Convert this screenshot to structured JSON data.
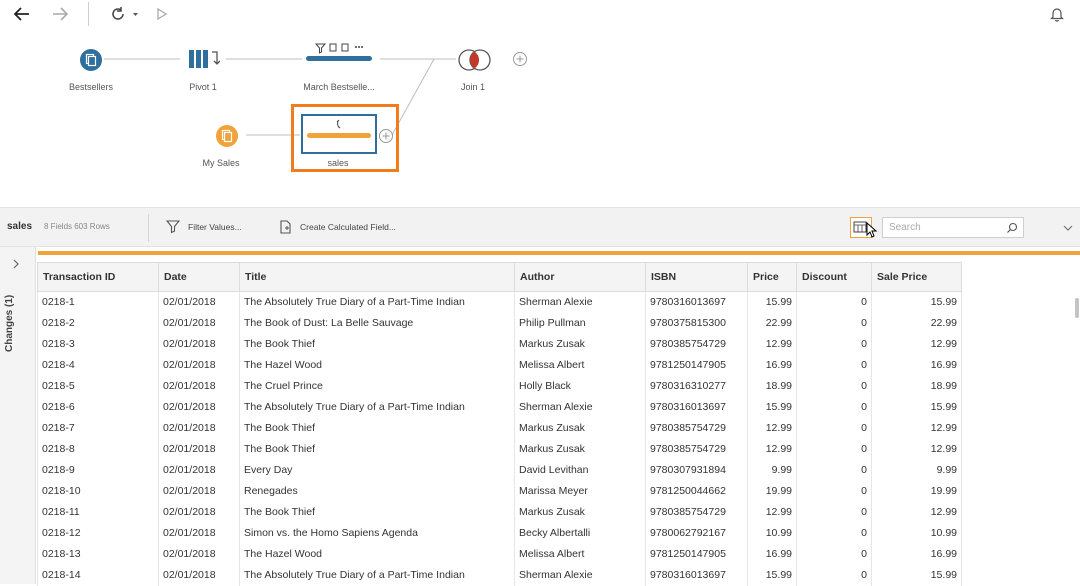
{
  "toolbar": {
    "back": "back-icon",
    "forward": "forward-icon",
    "refresh": "refresh-icon",
    "run": "run-icon",
    "alerts": "bell-icon"
  },
  "flow": {
    "nodes": [
      {
        "id": "bestsellers",
        "label": "Bestsellers",
        "type": "input",
        "color": "#2e6f9e"
      },
      {
        "id": "pivot",
        "label": "Pivot 1",
        "type": "pivot",
        "color": "#2e6f9e"
      },
      {
        "id": "march",
        "label": "March Bestselle...",
        "type": "clean",
        "color": "#2e6f9e"
      },
      {
        "id": "join",
        "label": "Join 1",
        "type": "join",
        "color": "#c0392b"
      },
      {
        "id": "mysales",
        "label": "My Sales",
        "type": "input",
        "color": "#f0a33a"
      },
      {
        "id": "sales",
        "label": "sales",
        "type": "clean",
        "color": "#f0a33a"
      }
    ],
    "highlight_color": "#f07c1e"
  },
  "profile": {
    "step_name": "sales",
    "meta": "8 Fields  603 Rows",
    "filter_label": "Filter Values...",
    "calc_label": "Create Calculated Field...",
    "search_placeholder": "Search"
  },
  "changes": {
    "label": "Changes (1)"
  },
  "table": {
    "columns": [
      "Transaction ID",
      "Date",
      "Title",
      "Author",
      "ISBN",
      "Price",
      "Discount",
      "Sale Price"
    ],
    "rows": [
      [
        "0218-1",
        "02/01/2018",
        "The Absolutely True Diary of a Part-Time Indian",
        "Sherman Alexie",
        "9780316013697",
        "15.99",
        "0",
        "15.99"
      ],
      [
        "0218-2",
        "02/01/2018",
        "The Book of Dust: La Belle Sauvage",
        "Philip Pullman",
        "9780375815300",
        "22.99",
        "0",
        "22.99"
      ],
      [
        "0218-3",
        "02/01/2018",
        "The Book Thief",
        "Markus Zusak",
        "9780385754729",
        "12.99",
        "0",
        "12.99"
      ],
      [
        "0218-4",
        "02/01/2018",
        "The Hazel Wood",
        "Melissa Albert",
        "9781250147905",
        "16.99",
        "0",
        "16.99"
      ],
      [
        "0218-5",
        "02/01/2018",
        "The Cruel Prince",
        "Holly Black",
        "9780316310277",
        "18.99",
        "0",
        "18.99"
      ],
      [
        "0218-6",
        "02/01/2018",
        "The Absolutely True Diary of a Part-Time Indian",
        "Sherman Alexie",
        "9780316013697",
        "15.99",
        "0",
        "15.99"
      ],
      [
        "0218-7",
        "02/01/2018",
        "The Book Thief",
        "Markus Zusak",
        "9780385754729",
        "12.99",
        "0",
        "12.99"
      ],
      [
        "0218-8",
        "02/01/2018",
        "The Book Thief",
        "Markus Zusak",
        "9780385754729",
        "12.99",
        "0",
        "12.99"
      ],
      [
        "0218-9",
        "02/01/2018",
        "Every Day",
        "David Levithan",
        "9780307931894",
        "9.99",
        "0",
        "9.99"
      ],
      [
        "0218-10",
        "02/01/2018",
        "Renegades",
        "Marissa Meyer",
        "9781250044662",
        "19.99",
        "0",
        "19.99"
      ],
      [
        "0218-11",
        "02/01/2018",
        "The Book Thief",
        "Markus Zusak",
        "9780385754729",
        "12.99",
        "0",
        "12.99"
      ],
      [
        "0218-12",
        "02/01/2018",
        "Simon vs. the Homo Sapiens Agenda",
        "Becky Albertalli",
        "9780062792167",
        "10.99",
        "0",
        "10.99"
      ],
      [
        "0218-13",
        "02/01/2018",
        "The Hazel Wood",
        "Melissa Albert",
        "9781250147905",
        "16.99",
        "0",
        "16.99"
      ],
      [
        "0218-14",
        "02/01/2018",
        "The Absolutely True Diary of a Part-Time Indian",
        "Sherman Alexie",
        "9780316013697",
        "15.99",
        "0",
        "15.99"
      ]
    ]
  }
}
